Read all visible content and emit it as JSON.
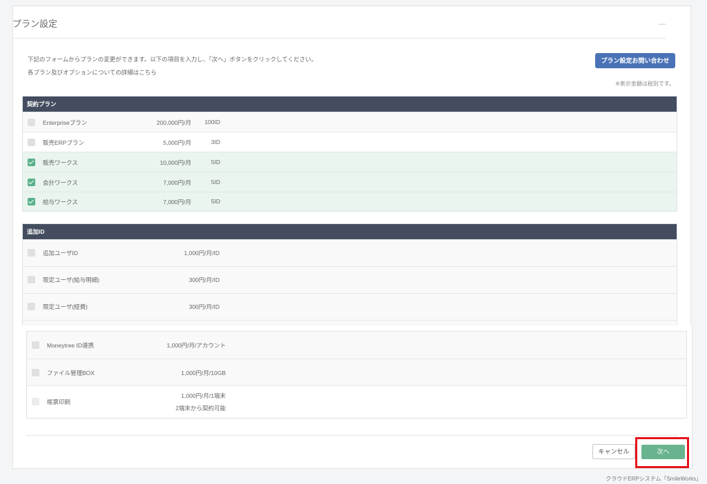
{
  "card": {
    "title": "プラン設定"
  },
  "intro": {
    "line1": "下記のフォームからプランの変更ができます。以下の項目を入力し、「次へ」ボタンをクリックしてください。",
    "line2": "各プラン及びオプションについての詳細はこちら"
  },
  "inquiry_button": "プラン設定お問い合わせ",
  "tax_note": "※表示金額は税別です。",
  "plans": {
    "header": "契約プラン",
    "rows": [
      {
        "name": "Enterpriseプラン",
        "price": "200,000円/月",
        "ids": "100ID",
        "checked": false
      },
      {
        "name": "販売ERPプラン",
        "price": "5,000円/月",
        "ids": "3ID",
        "checked": false
      },
      {
        "name": "販売ワークス",
        "price": "10,000円/月",
        "ids": "5ID",
        "checked": true
      },
      {
        "name": "会計ワークス",
        "price": "7,000円/月",
        "ids": "5ID",
        "checked": true
      },
      {
        "name": "給与ワークス",
        "price": "7,000円/月",
        "ids": "5ID",
        "checked": true
      }
    ]
  },
  "extra_ids": {
    "header": "追加ID",
    "rows": [
      {
        "name": "追加ユーザID",
        "price": "1,000円/月/ID"
      },
      {
        "name": "限定ユーザ(給与明細)",
        "price": "300円/月/ID"
      },
      {
        "name": "限定ユーザ(経費)",
        "price": "300円/月/ID"
      }
    ]
  },
  "options": {
    "rows": [
      {
        "name": "Moneytree ID連携",
        "price": "1,000円/月/アカウント"
      },
      {
        "name": "ファイル管理BOX",
        "price": "1,000円/月/10GB"
      },
      {
        "name": "帳票印刷",
        "price_line1": "1,000円/月/1端末",
        "price_line2": "2端末から契約可能"
      }
    ]
  },
  "buttons": {
    "cancel": "キャンセル",
    "next": "次へ"
  },
  "footer": "クラウドERPシステム「SmileWorks」",
  "colors": {
    "section_header": "#444d5f",
    "primary_button": "#4a72b6",
    "next_button": "#69b48e",
    "checked": "#5ab08a",
    "highlight": "#e5141b"
  }
}
